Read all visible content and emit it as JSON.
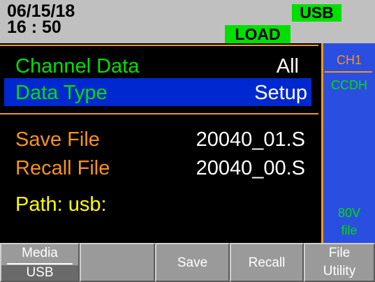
{
  "status_bar": {
    "date": "06/15/18",
    "time": "16 : 50",
    "usb_label": "USB",
    "load_label": "LOAD",
    "badge_color": "#00e000"
  },
  "panel": {
    "channel_data_label": "Channel Data",
    "channel_data_value": "All",
    "data_type_label": "Data Type",
    "data_type_value": "Setup",
    "save_file_label": "Save File",
    "save_file_value": "20040_01.S",
    "recall_file_label": "Recall File",
    "recall_file_value": "20040_00.S",
    "path_label": "Path:  usb:"
  },
  "side_info": {
    "channel": "CH1",
    "mode": "CCDH",
    "voltage": "80V",
    "file": "file"
  },
  "softkeys": [
    {
      "top": "Media",
      "bottom": "USB"
    },
    {
      "label": ""
    },
    {
      "label": "Save"
    },
    {
      "label": "Recall"
    },
    {
      "top": "File",
      "bottom": "Utility"
    }
  ],
  "colors": {
    "header_bg": "#c0c0c0",
    "highlight_bg": "#0028d0",
    "side_bg": "#2a4ee0",
    "accent_orange": "#f7931e",
    "green": "#00e000",
    "yellow": "#ffff00"
  }
}
